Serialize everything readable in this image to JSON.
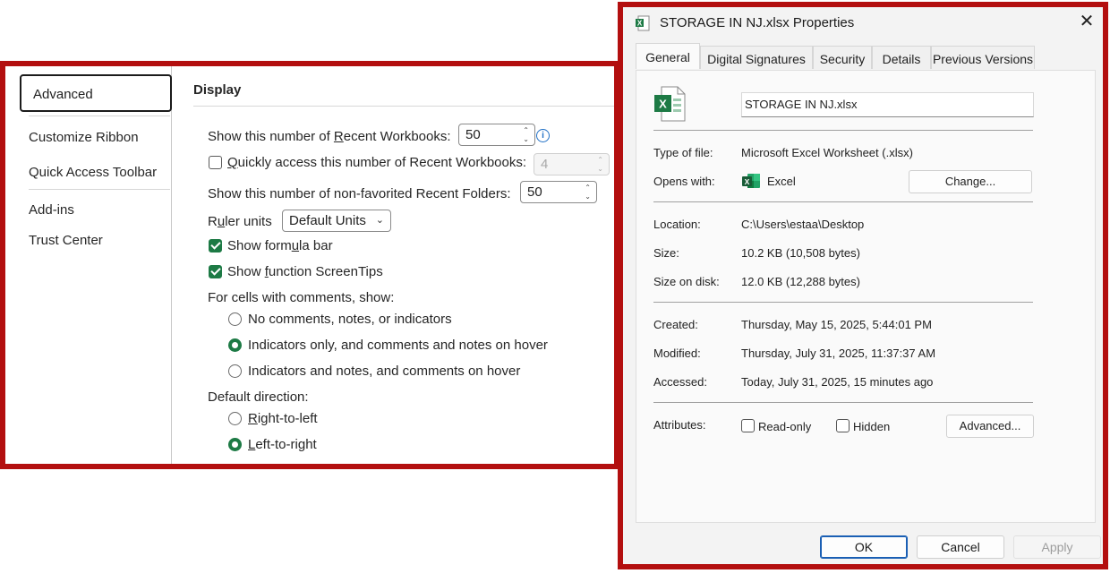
{
  "options": {
    "sidebar": {
      "items": [
        {
          "label": "Advanced"
        },
        {
          "label": "Customize Ribbon"
        },
        {
          "label": "Quick Access Toolbar"
        },
        {
          "label": "Add-ins"
        },
        {
          "label": "Trust Center"
        }
      ],
      "selected": "Advanced"
    },
    "section_title": "Display",
    "recent_workbooks": {
      "label_pre": "Show this number of ",
      "label_key": "R",
      "label_post": "ecent Workbooks:",
      "value": "50"
    },
    "quick_access": {
      "label_key": "Q",
      "label_post": "uickly access this number of Recent Workbooks:",
      "value": "4",
      "checked": false
    },
    "recent_folders": {
      "label": "Show this number of non-favorited Recent Folders:",
      "value": "50"
    },
    "ruler_units": {
      "label_pre": "R",
      "label_key": "u",
      "label_post": "ler units",
      "value": "Default Units"
    },
    "formula_bar": {
      "label_pre": "Show form",
      "label_key": "u",
      "label_post": "la bar",
      "checked": true
    },
    "screentips": {
      "label_pre": "Show ",
      "label_key": "f",
      "label_post": "unction ScreenTips",
      "checked": true
    },
    "comments_heading": "For cells with comments, show:",
    "comments_options": [
      {
        "label": "No comments, notes, or indicators",
        "selected": false
      },
      {
        "label": "Indicators only, and comments and notes on hover",
        "selected": true
      },
      {
        "label": "Indicators and notes, and comments on hover",
        "selected": false
      }
    ],
    "direction_heading": "Default direction:",
    "direction_options": [
      {
        "label_key": "R",
        "label_post": "ight-to-left",
        "selected": false
      },
      {
        "label_key": "L",
        "label_post": "eft-to-right",
        "selected": true
      }
    ]
  },
  "properties": {
    "title": "STORAGE IN NJ.xlsx Properties",
    "tabs": [
      "General",
      "Digital Signatures",
      "Security",
      "Details",
      "Previous Versions"
    ],
    "active_tab": "General",
    "filename": "STORAGE IN NJ.xlsx",
    "type_of_file": {
      "label": "Type of file:",
      "value": "Microsoft Excel Worksheet (.xlsx)"
    },
    "opens_with": {
      "label": "Opens with:",
      "value": "Excel",
      "button": "Change..."
    },
    "location": {
      "label": "Location:",
      "value": "C:\\Users\\estaa\\Desktop"
    },
    "size": {
      "label": "Size:",
      "value": "10.2 KB (10,508 bytes)"
    },
    "size_on_disk": {
      "label": "Size on disk:",
      "value": "12.0 KB (12,288 bytes)"
    },
    "created": {
      "label": "Created:",
      "value": "Thursday, May 15, 2025, 5:44:01 PM"
    },
    "modified": {
      "label": "Modified:",
      "value": "Thursday, July 31, 2025, 11:37:37 AM"
    },
    "accessed": {
      "label": "Accessed:",
      "value": "Today, July 31, 2025, 15 minutes ago"
    },
    "attributes": {
      "label": "Attributes:",
      "read_only": "Read-only",
      "hidden": "Hidden",
      "advanced_button": "Advanced..."
    },
    "buttons": {
      "ok": "OK",
      "cancel": "Cancel",
      "apply": "Apply"
    }
  },
  "colors": {
    "highlight_border": "#b30f0f",
    "excel_green": "#1d7a45",
    "info_blue": "#1f6fc5"
  }
}
